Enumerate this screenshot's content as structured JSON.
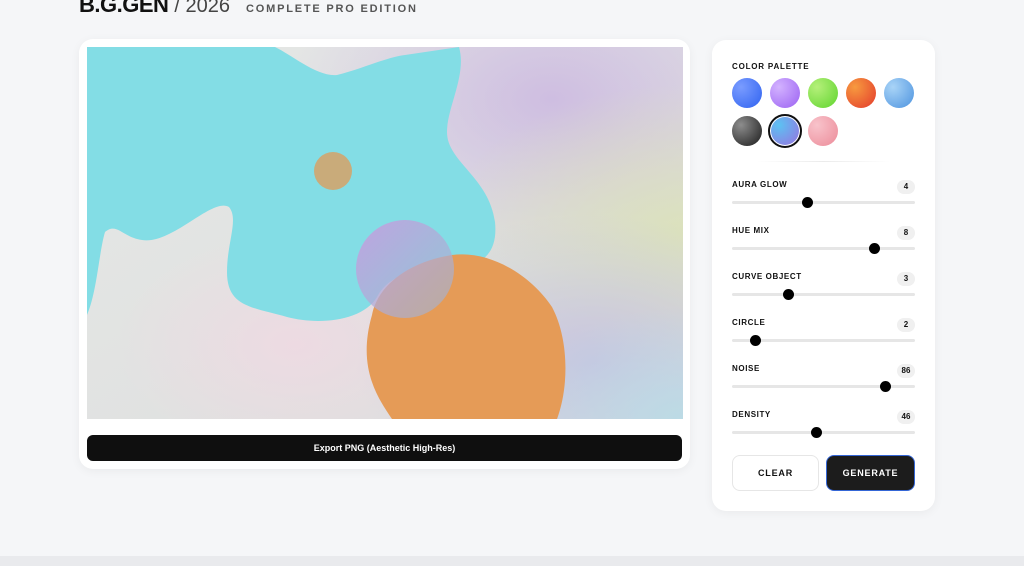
{
  "header": {
    "brand": "B.G.GEN",
    "year": "/ 2026",
    "edition": "COMPLETE PRO EDITION"
  },
  "canvas": {
    "export_label": "Export PNG (Aesthetic High-Res)"
  },
  "palette": {
    "label": "COLOR PALETTE",
    "selected_index": 6,
    "swatches": [
      {
        "name": "blue",
        "colors": [
          "#2f62f0",
          "#7a9cff"
        ]
      },
      {
        "name": "violet",
        "colors": [
          "#9b62f2",
          "#d3b2ff"
        ]
      },
      {
        "name": "green",
        "colors": [
          "#5fd42e",
          "#b5f07a"
        ]
      },
      {
        "name": "red-orange",
        "colors": [
          "#e33a2c",
          "#f79a3f"
        ]
      },
      {
        "name": "sky",
        "colors": [
          "#4d93df",
          "#a9d4f7"
        ]
      },
      {
        "name": "charcoal",
        "colors": [
          "#1a1a1a",
          "#8d8d8d"
        ]
      },
      {
        "name": "iris-sky",
        "colors": [
          "#9a6fe0",
          "#5cc2f2"
        ]
      },
      {
        "name": "rose",
        "colors": [
          "#ec8b99",
          "#f8c3cb"
        ]
      }
    ]
  },
  "controls": {
    "sliders": [
      {
        "label": "AURA GLOW",
        "value": "4",
        "fraction": 0.41
      },
      {
        "label": "HUE MIX",
        "value": "8",
        "fraction": 0.78
      },
      {
        "label": "CURVE OBJECT",
        "value": "3",
        "fraction": 0.31
      },
      {
        "label": "CIRCLE",
        "value": "2",
        "fraction": 0.13
      },
      {
        "label": "NOISE",
        "value": "86",
        "fraction": 0.84
      },
      {
        "label": "DENSITY",
        "value": "46",
        "fraction": 0.46
      }
    ]
  },
  "actions": {
    "clear_label": "CLEAR",
    "generate_label": "GENERATE"
  },
  "colors": {
    "cyan_blob": "#83dde5",
    "orange_blob": "#e59b57",
    "gold_circle": "#c9ab7a",
    "generate_border": "#3466d6"
  }
}
